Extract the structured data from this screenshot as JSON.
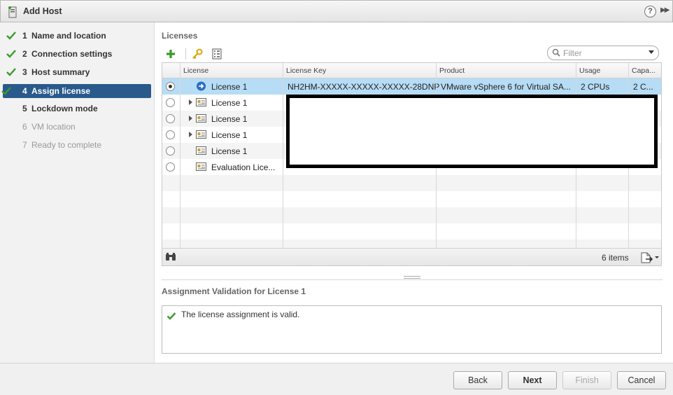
{
  "window": {
    "title": "Add Host",
    "help_label": "?"
  },
  "steps": [
    {
      "num": "1",
      "label": "Name and location",
      "done": true,
      "state": "normal"
    },
    {
      "num": "2",
      "label": "Connection settings",
      "done": true,
      "state": "normal"
    },
    {
      "num": "3",
      "label": "Host summary",
      "done": true,
      "state": "normal"
    },
    {
      "num": "4",
      "label": "Assign license",
      "done": true,
      "state": "active"
    },
    {
      "num": "5",
      "label": "Lockdown mode",
      "done": false,
      "state": "normal"
    },
    {
      "num": "6",
      "label": "VM location",
      "done": false,
      "state": "disabled"
    },
    {
      "num": "7",
      "label": "Ready to complete",
      "done": false,
      "state": "disabled"
    }
  ],
  "licenses": {
    "section_title": "Licenses",
    "toolbar": {
      "add_icon": "plus-icon",
      "key_icon": "key-icon",
      "details_icon": "checklist-icon"
    },
    "filter": {
      "placeholder": "Filter"
    },
    "columns": [
      "License",
      "License Key",
      "Product",
      "Usage",
      "Capa..."
    ],
    "rows": [
      {
        "name": "License 1",
        "key": "NH2HM-XXXXX-XXXXX-XXXXX-28DNP",
        "product": "VMware vSphere 6 for Virtual SA...",
        "usage": "2 CPUs",
        "capacity": "2 C...",
        "selected": true,
        "expandable": false,
        "icon": "arrow-right-circle-icon"
      },
      {
        "name": "License 1",
        "key": "",
        "product": "",
        "usage": "",
        "capacity": "",
        "selected": false,
        "expandable": true,
        "icon": "license-card-icon"
      },
      {
        "name": "License 1",
        "key": "",
        "product": "",
        "usage": "",
        "capacity": "",
        "selected": false,
        "expandable": true,
        "icon": "license-card-icon"
      },
      {
        "name": "License 1",
        "key": "",
        "product": "",
        "usage": "",
        "capacity": "",
        "selected": false,
        "expandable": true,
        "icon": "license-card-icon"
      },
      {
        "name": "License 1",
        "key": "",
        "product": "",
        "usage": "",
        "capacity": "",
        "selected": false,
        "expandable": false,
        "icon": "license-card-icon"
      },
      {
        "name": "Evaluation Lice...",
        "key": "",
        "product": "",
        "usage": "",
        "capacity": "",
        "selected": false,
        "expandable": false,
        "icon": "license-card-icon"
      }
    ],
    "items_count": "6 items"
  },
  "validation": {
    "title": "Assignment Validation for License 1",
    "message": "The license assignment is valid."
  },
  "buttons": {
    "back": "Back",
    "next": "Next",
    "finish": "Finish",
    "cancel": "Cancel"
  },
  "colors": {
    "accent": "#2a5a8c",
    "selection": "#b7dcf5",
    "check": "#3a9a2a"
  }
}
